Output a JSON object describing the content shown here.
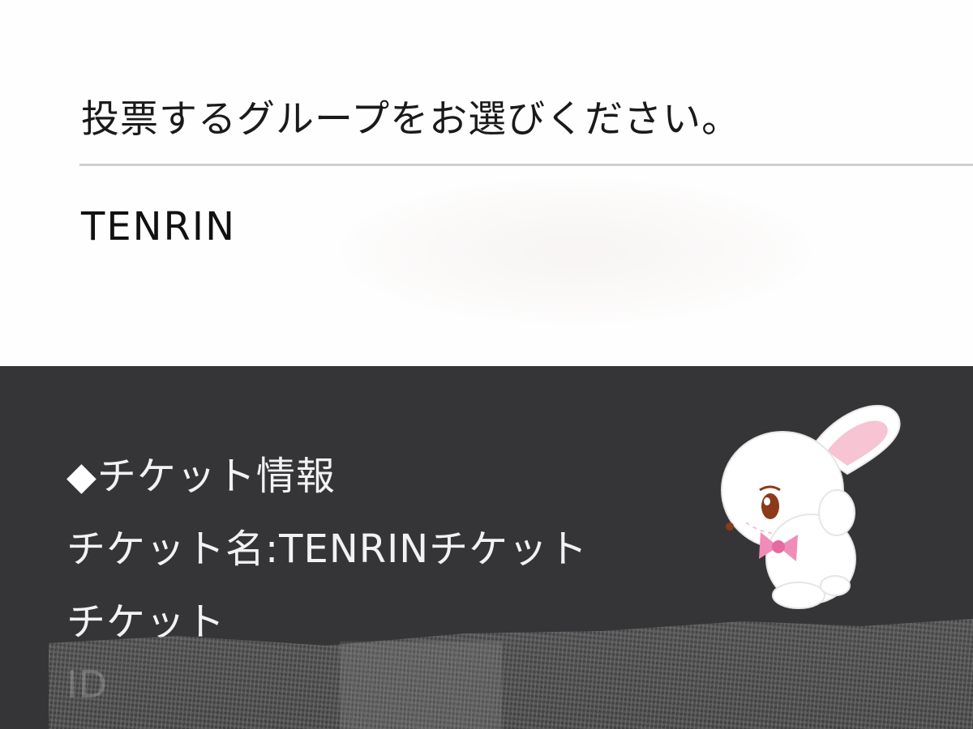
{
  "vote": {
    "prompt": "投票するグループをお選びください。",
    "option": "TENRIN"
  },
  "ticket": {
    "heading_marker": "◆",
    "heading": "チケット情報",
    "name_line": "チケット名:TENRINチケット",
    "type_line": "チケット",
    "id_label": "ID"
  },
  "sticker": {
    "icon": "bunny-sticker-icon",
    "bow_color": "#f08cb8",
    "ear_color": "#f6c4d3"
  }
}
